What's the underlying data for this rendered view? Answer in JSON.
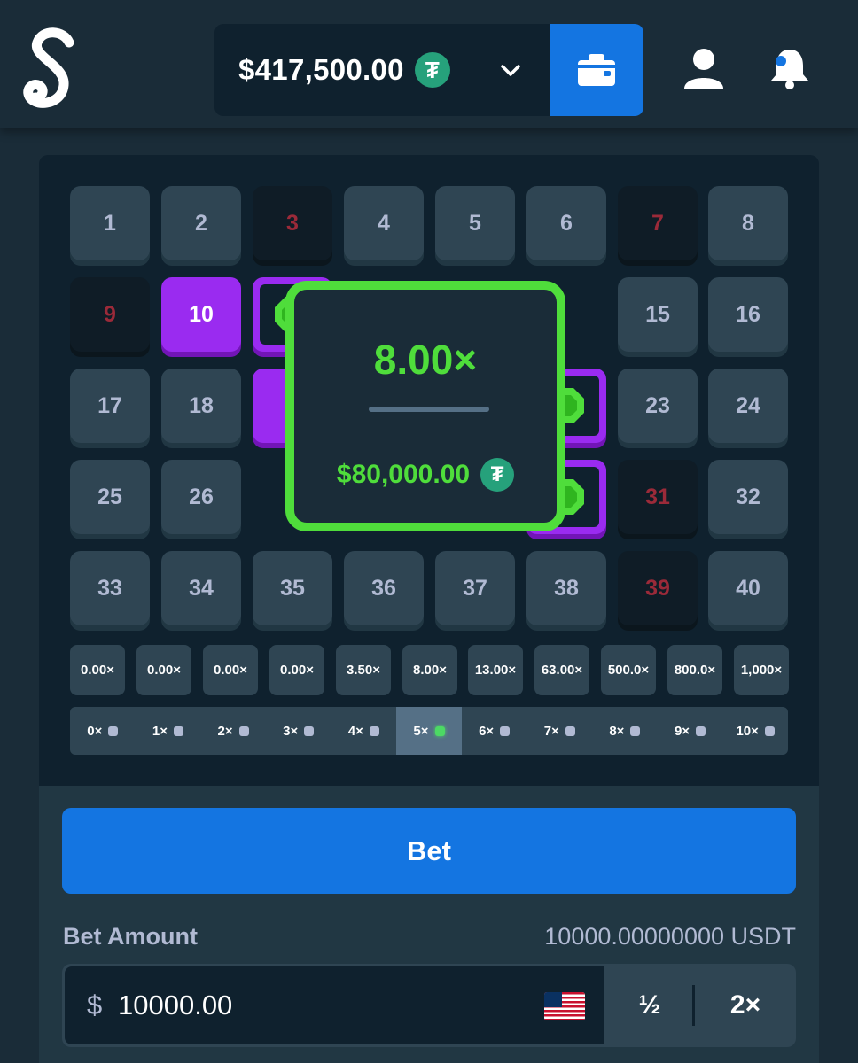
{
  "header": {
    "balance": "$417,500.00",
    "currency_icon": "tether-icon",
    "currency_symbol": "₮",
    "accent": "#1475e1"
  },
  "grid": {
    "rows": [
      [
        {
          "n": "1",
          "s": "default"
        },
        {
          "n": "2",
          "s": "default"
        },
        {
          "n": "3",
          "s": "miss"
        },
        {
          "n": "4",
          "s": "default"
        },
        {
          "n": "5",
          "s": "default"
        },
        {
          "n": "6",
          "s": "default"
        },
        {
          "n": "7",
          "s": "miss"
        },
        {
          "n": "8",
          "s": "default"
        }
      ],
      [
        {
          "n": "9",
          "s": "miss"
        },
        {
          "n": "10",
          "s": "selected"
        },
        {
          "n": "",
          "s": "hit"
        },
        {
          "n": "",
          "s": "hidden"
        },
        {
          "n": "",
          "s": "hidden"
        },
        {
          "n": "",
          "s": "hidden"
        },
        {
          "n": "15",
          "s": "default"
        },
        {
          "n": "16",
          "s": "default"
        }
      ],
      [
        {
          "n": "17",
          "s": "default"
        },
        {
          "n": "18",
          "s": "default"
        },
        {
          "n": "",
          "s": "selected-covered"
        },
        {
          "n": "",
          "s": "hidden"
        },
        {
          "n": "",
          "s": "hidden"
        },
        {
          "n": "",
          "s": "hit"
        },
        {
          "n": "23",
          "s": "default"
        },
        {
          "n": "24",
          "s": "default"
        }
      ],
      [
        {
          "n": "25",
          "s": "default"
        },
        {
          "n": "26",
          "s": "default"
        },
        {
          "n": "",
          "s": "hidden"
        },
        {
          "n": "",
          "s": "hidden"
        },
        {
          "n": "",
          "s": "hidden"
        },
        {
          "n": "",
          "s": "hit"
        },
        {
          "n": "31",
          "s": "miss"
        },
        {
          "n": "32",
          "s": "default"
        }
      ],
      [
        {
          "n": "33",
          "s": "default"
        },
        {
          "n": "34",
          "s": "default"
        },
        {
          "n": "35",
          "s": "default"
        },
        {
          "n": "36",
          "s": "default"
        },
        {
          "n": "37",
          "s": "default"
        },
        {
          "n": "38",
          "s": "default"
        },
        {
          "n": "39",
          "s": "miss"
        },
        {
          "n": "40",
          "s": "default"
        }
      ]
    ],
    "colors": {
      "selected": "#9a2bf0",
      "miss_text": "#9b2a39",
      "gem": "#4fdd3b"
    }
  },
  "payouts": [
    "0.00×",
    "0.00×",
    "0.00×",
    "0.00×",
    "3.50×",
    "8.00×",
    "13.00×",
    "63.00×",
    "500.0×",
    "800.0×",
    "1,000×"
  ],
  "hits": [
    {
      "label": "0×",
      "active": false
    },
    {
      "label": "1×",
      "active": false
    },
    {
      "label": "2×",
      "active": false
    },
    {
      "label": "3×",
      "active": false
    },
    {
      "label": "4×",
      "active": false
    },
    {
      "label": "5×",
      "active": true
    },
    {
      "label": "6×",
      "active": false
    },
    {
      "label": "7×",
      "active": false
    },
    {
      "label": "8×",
      "active": false
    },
    {
      "label": "9×",
      "active": false
    },
    {
      "label": "10×",
      "active": false
    }
  ],
  "popup": {
    "multiplier": "8.00×",
    "win_amount": "$80,000.00",
    "currency_symbol": "₮",
    "color": "#4fdd3b"
  },
  "controls": {
    "bet_label": "Bet",
    "bet_amount_label": "Bet Amount",
    "bet_amount_crypto": "10000.00000000 USDT",
    "dollar_sign": "$",
    "bet_value": "10000.00",
    "half_label": "½",
    "double_label": "2×",
    "flag_icon": "us-flag-icon"
  }
}
